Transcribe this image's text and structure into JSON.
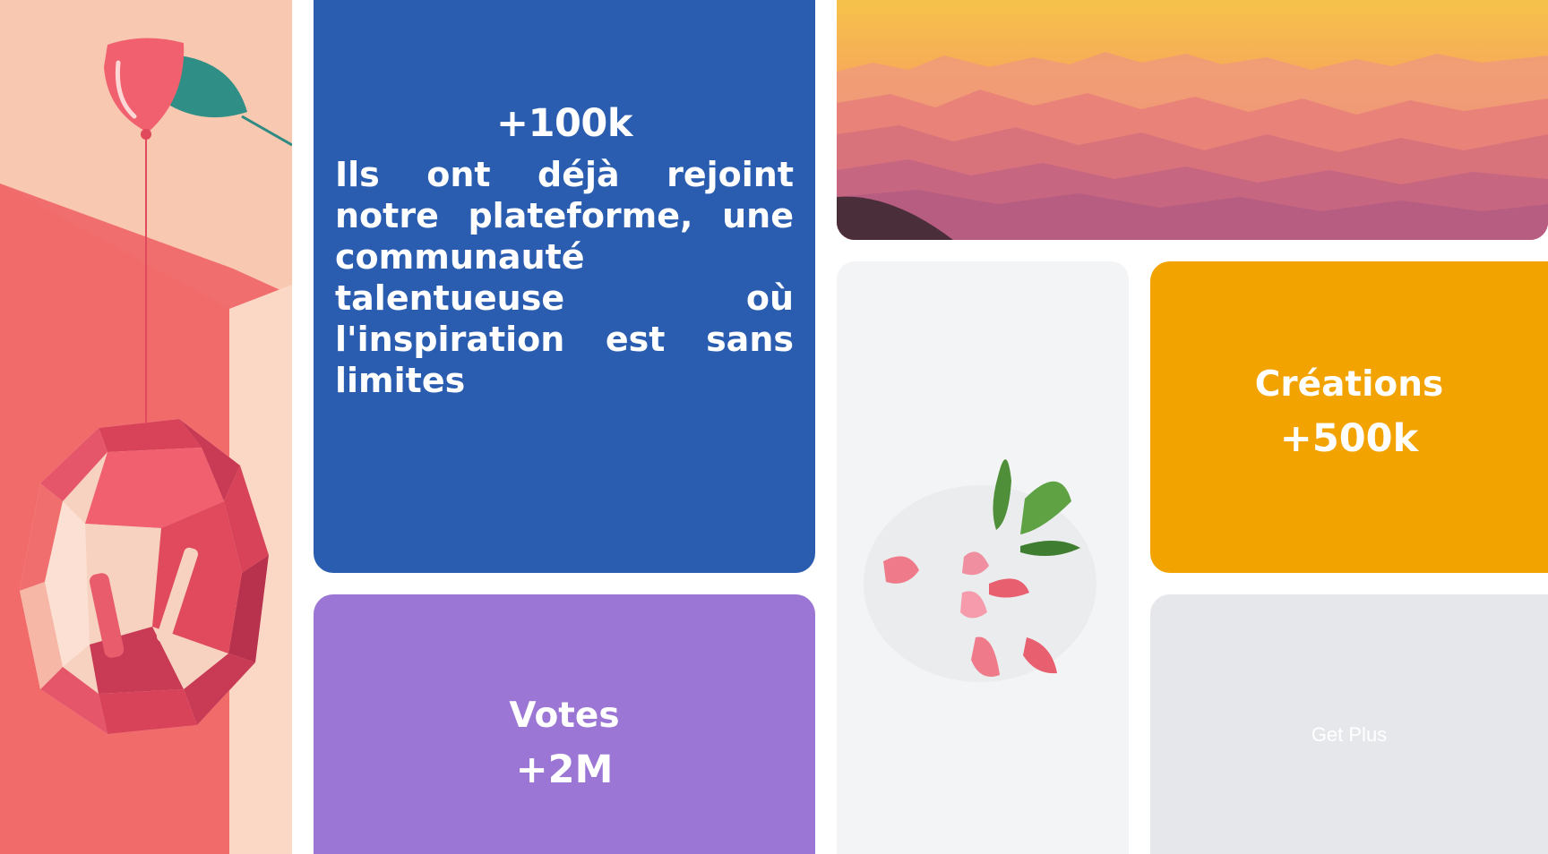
{
  "colors": {
    "blue_card": "#2a5db0",
    "purple_card": "#9b76d4",
    "orange_card": "#f2a300",
    "grey_card": "#e5e7eb",
    "flower_bg": "#f3f4f6"
  },
  "users_stat": {
    "count": "+100k",
    "description": "Ils ont déjà rejoint notre plateforme, une communauté talentueuse où l'inspiration est sans limites"
  },
  "votes_stat": {
    "label": "Votes",
    "value": "+2M"
  },
  "creations_stat": {
    "label": "Créations",
    "value": "+500k"
  },
  "get_plus": {
    "label": "Get Plus"
  }
}
